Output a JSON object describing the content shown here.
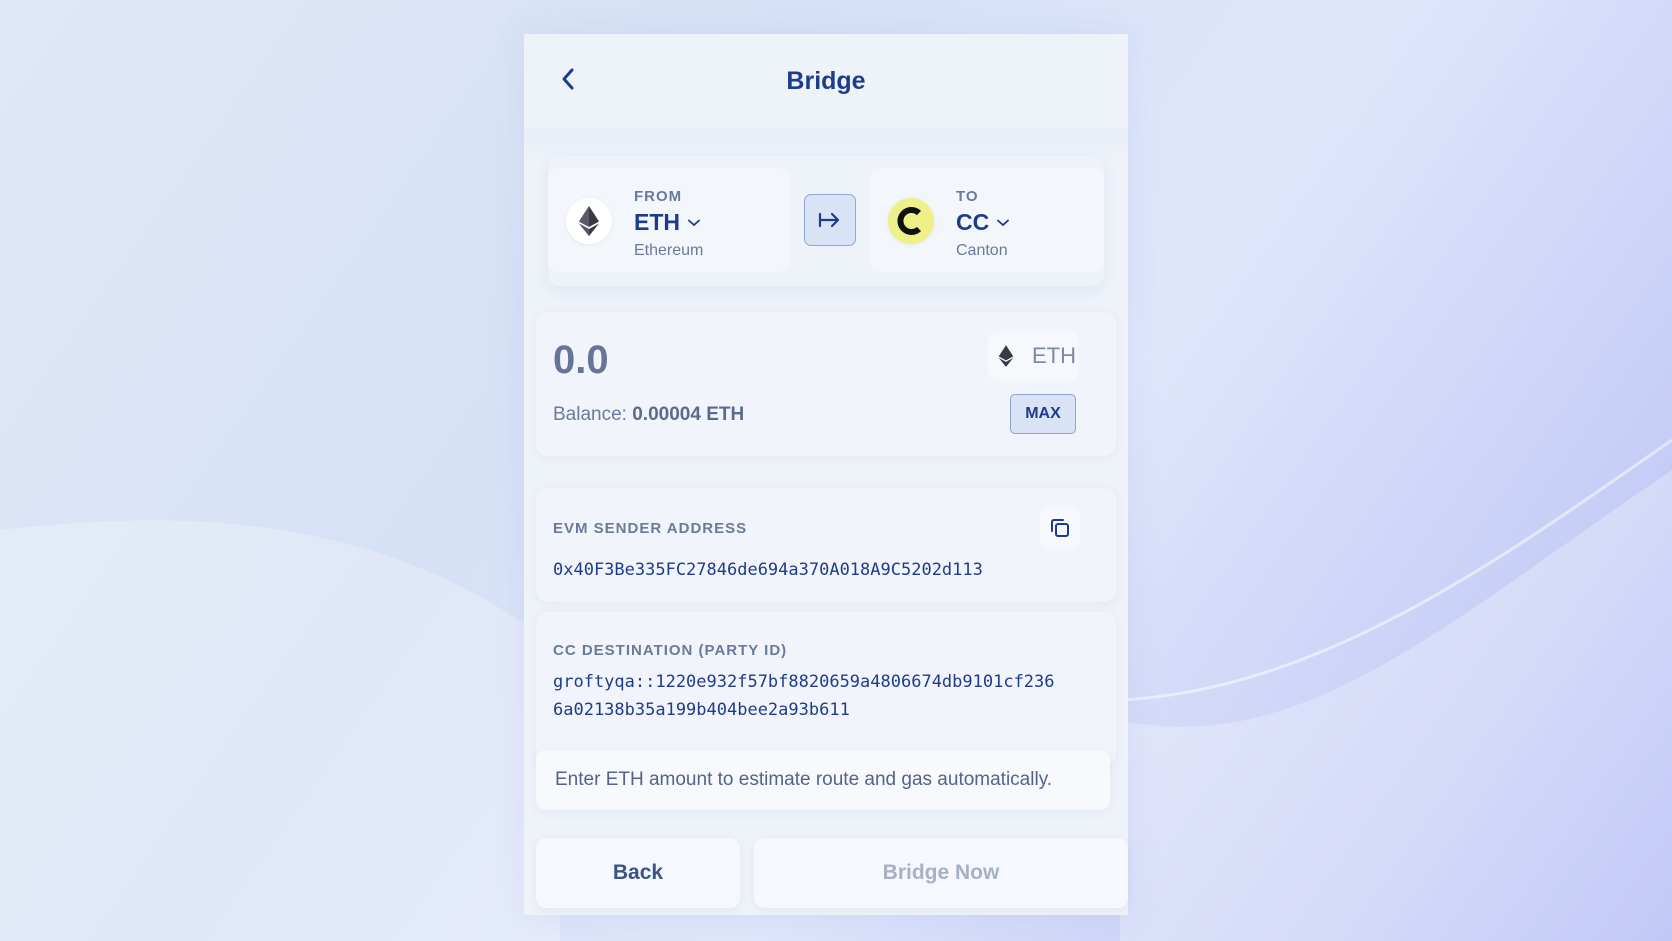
{
  "header": {
    "title": "Bridge"
  },
  "from": {
    "label": "FROM",
    "symbol": "ETH",
    "name": "Ethereum"
  },
  "to": {
    "label": "TO",
    "symbol": "CC",
    "name": "Canton"
  },
  "amount": {
    "value": "0.0",
    "token": "ETH",
    "balance_label": "Balance:",
    "balance_value": "0.00004 ETH",
    "max_label": "MAX"
  },
  "sender": {
    "label": "EVM SENDER ADDRESS",
    "address": "0x40F3Be335FC27846de694a370A018A9C5202d113"
  },
  "destination": {
    "label": "CC DESTINATION (PARTY ID)",
    "line1": "groftyqa::1220e932f57bf8820659a4806674db9101cf236",
    "line2": "6a02138b35a199b404bee2a93b611"
  },
  "hint": "Enter ETH amount to estimate route and gas automatically.",
  "buttons": {
    "back": "Back",
    "bridge": "Bridge Now"
  },
  "colors": {
    "accent": "#1f3c8c",
    "panel": "#eef2f9",
    "muted": "#6b7a9c"
  },
  "icons": [
    "back-chevron-icon",
    "eth-logo-icon",
    "cc-logo-icon",
    "arrow-right-icon",
    "chevron-down-icon",
    "copy-icon"
  ]
}
